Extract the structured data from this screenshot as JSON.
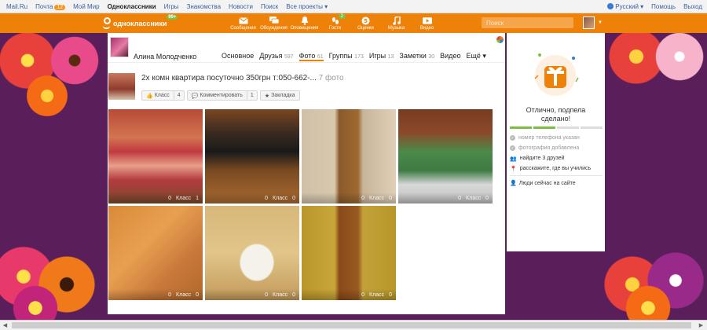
{
  "portal": {
    "links": [
      "Mail.Ru",
      "Почта",
      "Мой Мир",
      "Одноклассники",
      "Игры",
      "Знакомства",
      "Новости",
      "Поиск",
      "Все проекты ▾"
    ],
    "mail_count": "12",
    "language": "Русский ▾",
    "help": "Помощь",
    "logout": "Выход"
  },
  "header": {
    "logo": "одноклассники",
    "logo_badge": "99+",
    "nav": [
      {
        "label": "Сообщения",
        "icon": "envelope-icon",
        "count": ""
      },
      {
        "label": "Обсуждения",
        "icon": "chat-icon",
        "count": ""
      },
      {
        "label": "Оповещения",
        "icon": "bell-icon",
        "count": ""
      },
      {
        "label": "Гости",
        "icon": "footprint-icon",
        "count": "2"
      },
      {
        "label": "Оценки",
        "icon": "rating-icon",
        "count": ""
      },
      {
        "label": "Музыка",
        "icon": "music-icon",
        "count": ""
      },
      {
        "label": "Видео",
        "icon": "video-icon",
        "count": ""
      }
    ],
    "search_placeholder": "Поиск"
  },
  "profile": {
    "name": "Алина Молодченко",
    "tabs": [
      {
        "label": "Основное",
        "count": ""
      },
      {
        "label": "Друзья",
        "count": "597"
      },
      {
        "label": "Фото",
        "count": "61"
      },
      {
        "label": "Группы",
        "count": "173"
      },
      {
        "label": "Игры",
        "count": "13"
      },
      {
        "label": "Заметки",
        "count": "30"
      },
      {
        "label": "Видео",
        "count": ""
      },
      {
        "label": "Ещё ▾",
        "count": ""
      }
    ]
  },
  "album": {
    "title": "2х комн квартира посуточно 350грн т:050-662-...",
    "photo_count": "7 фото",
    "like_label": "Класс",
    "like_count": "4",
    "comment_label": "Комментировать",
    "comment_count": "1",
    "bookmark_label": "Закладка"
  },
  "photos": [
    {
      "comments": "0",
      "like_label": "Класс",
      "likes": "1"
    },
    {
      "comments": "0",
      "like_label": "Класс",
      "likes": "0"
    },
    {
      "comments": "0",
      "like_label": "Класс",
      "likes": "0"
    },
    {
      "comments": "0",
      "like_label": "Класс",
      "likes": "0"
    },
    {
      "comments": "0",
      "like_label": "Класс",
      "likes": "0"
    },
    {
      "comments": "0",
      "like_label": "Класс",
      "likes": "0"
    },
    {
      "comments": "0",
      "like_label": "Класс",
      "likes": "0"
    }
  ],
  "sidebar": {
    "done_line1": "Отлично, подпела",
    "done_line2": "сделано!",
    "tasks": [
      {
        "label": "номер телефона указан",
        "done": true
      },
      {
        "label": "фотография добавлена",
        "done": true
      },
      {
        "label": "найдите 3 друзей",
        "done": false
      },
      {
        "label": "расскажите, где вы учились",
        "done": false
      }
    ],
    "online": "Люди сейчас на сайте"
  },
  "colors": {
    "brand": "#ee8208",
    "accent_green": "#7bc043",
    "link": "#3a5fa0"
  }
}
